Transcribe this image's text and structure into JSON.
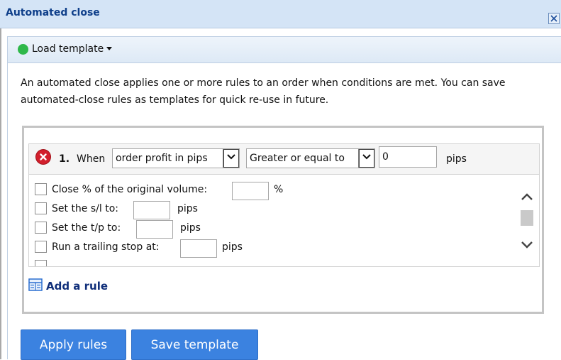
{
  "window": {
    "title": "Automated close"
  },
  "toolbar": {
    "load_template_label": "Load template",
    "status_color": "#2fb84a"
  },
  "intro_text": "An automated close applies one or more rules to an order when conditions are met. You can save automated-close rules as templates for quick re-use in future.",
  "rule": {
    "number": "1.",
    "when_label": "When",
    "condition": "order profit in pips",
    "comparison": "Greater or equal to",
    "value": "0",
    "unit": "pips"
  },
  "actions": [
    {
      "label": "Close % of the original volume:",
      "unit": "%"
    },
    {
      "label": "Set the s/l to:",
      "unit": "pips"
    },
    {
      "label": "Set the t/p to:",
      "unit": "pips"
    },
    {
      "label": "Run a trailing stop at:",
      "unit": "pips"
    }
  ],
  "add_rule_label": "Add a rule",
  "buttons": {
    "apply": "Apply rules",
    "save": "Save template"
  },
  "colors": {
    "accent": "#3b82e0",
    "header_bg": "#d4e4f6",
    "title": "#0f3f8a",
    "remove": "#d21f2c"
  }
}
